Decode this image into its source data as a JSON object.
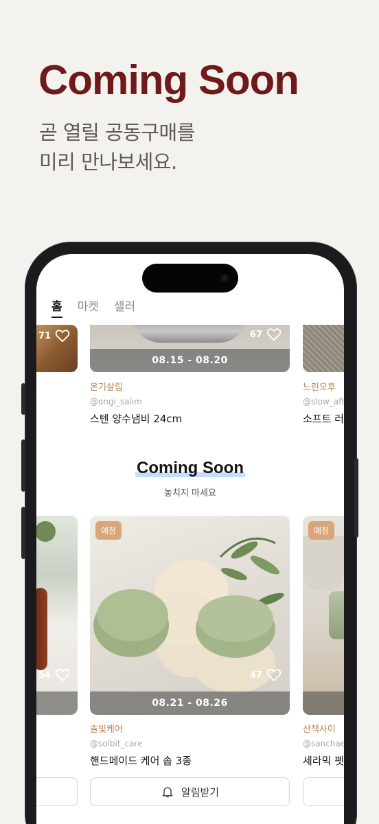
{
  "hero": {
    "title": "Coming Soon",
    "subtitle_line1": "곧 열릴 공동구매를",
    "subtitle_line2": "미리 만나보세요."
  },
  "tabs": [
    {
      "label": "홈",
      "active": true
    },
    {
      "label": "마켓",
      "active": false
    },
    {
      "label": "셀러",
      "active": false
    }
  ],
  "top_row": {
    "left_likes": "71",
    "center": {
      "likes": "67",
      "dates": "08.15 - 08.20",
      "seller": "온기살림",
      "handle": "@ongi_salim",
      "name": "스텐 양수냄비 24cm"
    },
    "right": {
      "seller": "느린오후",
      "handle": "@slow_afte",
      "name": "소프트 러"
    }
  },
  "section": {
    "title": "Coming Soon",
    "subtitle": "놓치지 마세요"
  },
  "bottom_row": {
    "left_likes": "54",
    "center": {
      "badge": "예정",
      "likes": "47",
      "dates": "08.21 - 08.26",
      "seller": "솔빛케어",
      "handle": "@solbit_care",
      "name": "핸드메이드 케어 솝 3종",
      "notify": "알림받기"
    },
    "right": {
      "badge": "예정",
      "seller": "산책사이",
      "handle": "@sanchaei",
      "name": "세라믹 펫"
    }
  },
  "colors": {
    "brand": "#6e1a1a",
    "seller": "#b7844d",
    "badge": "#d9a57a"
  }
}
